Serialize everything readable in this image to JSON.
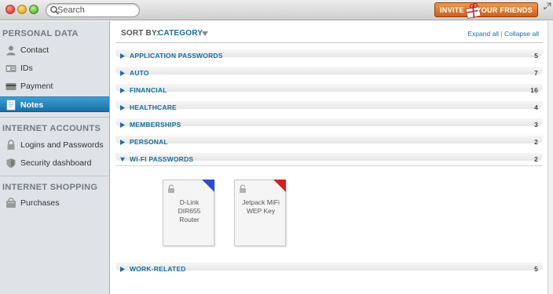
{
  "titlebar": {
    "search_placeholder": "Search",
    "invite_left": "INVITE",
    "invite_right": "YOUR FRIENDS"
  },
  "sidebar": {
    "sections": [
      {
        "header": "PERSONAL DATA",
        "items": [
          {
            "label": "Contact",
            "icon": "person-icon"
          },
          {
            "label": "IDs",
            "icon": "id-card-icon"
          },
          {
            "label": "Payment",
            "icon": "credit-card-icon"
          },
          {
            "label": "Notes",
            "icon": "note-icon",
            "selected": true
          }
        ]
      },
      {
        "header": "INTERNET ACCOUNTS",
        "items": [
          {
            "label": "Logins and Passwords",
            "icon": "lock-icon"
          },
          {
            "label": "Security dashboard",
            "icon": "shield-icon"
          }
        ]
      },
      {
        "header": "INTERNET SHOPPING",
        "items": [
          {
            "label": "Purchases",
            "icon": "shopping-icon"
          }
        ]
      }
    ]
  },
  "main": {
    "sort_label": "SORT BY:",
    "sort_value": "CATEGORY",
    "expand_all": "Expand all",
    "separator": "|",
    "collapse_all": "Collapse all",
    "categories": [
      {
        "name": "APPLICATION PASSWORDS",
        "count": "5",
        "expanded": false
      },
      {
        "name": "AUTO",
        "count": "7",
        "expanded": false
      },
      {
        "name": "FINANCIAL",
        "count": "16",
        "expanded": false
      },
      {
        "name": "HEALTHCARE",
        "count": "4",
        "expanded": false
      },
      {
        "name": "MEMBERSHIPS",
        "count": "3",
        "expanded": false
      },
      {
        "name": "PERSONAL",
        "count": "2",
        "expanded": false
      },
      {
        "name": "WI-FI PASSWORDS",
        "count": "2",
        "expanded": true
      },
      {
        "name": "WORK-RELATED",
        "count": "5",
        "expanded": false
      }
    ],
    "notes": [
      {
        "lines": [
          "D-Link",
          "DIR655",
          "Router"
        ],
        "corner_color": "#2a4fc9"
      },
      {
        "lines": [
          "Jetpack MiFi",
          "WEP Key"
        ],
        "corner_color": "#d42020"
      }
    ]
  },
  "colors": {
    "accent": "#1a6ea1",
    "selected_bg": "#2a86bd",
    "sidebar_bg": "#dfe3e7",
    "invite_bg": "#e07a2e"
  }
}
